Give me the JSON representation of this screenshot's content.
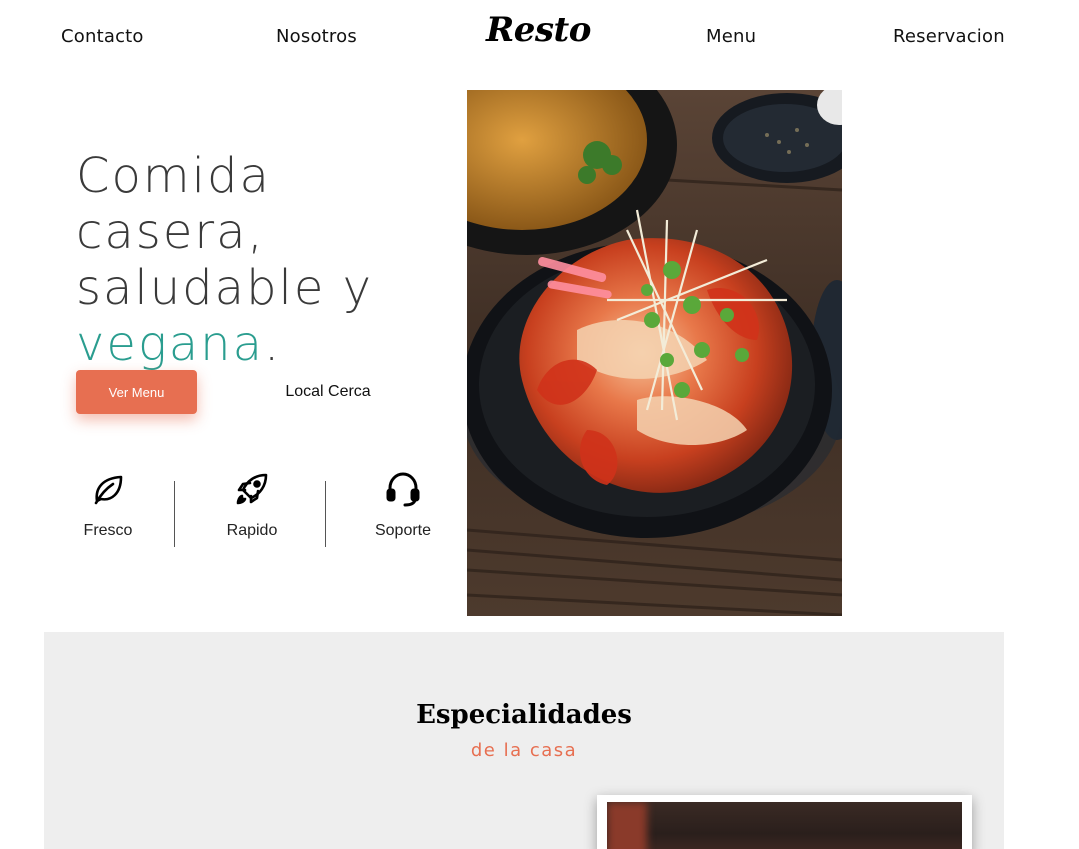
{
  "nav": {
    "logo": "Resto",
    "links": [
      "Contacto",
      "Nosotros",
      "Menu",
      "Reservacion"
    ]
  },
  "hero": {
    "title_line1": "Comida casera,",
    "title_line2": "saludable y",
    "title_accent": "vegana",
    "title_end": ".",
    "primary_button": "Ver Menu",
    "secondary_button": "Local Cerca",
    "features": [
      {
        "icon": "leaf-icon",
        "label": "Fresco"
      },
      {
        "icon": "rocket-icon",
        "label": "Rapido"
      },
      {
        "icon": "headset-icon",
        "label": "Soporte"
      }
    ],
    "image": "kimchi-bowl-photo"
  },
  "specialties": {
    "title": "Especialidades",
    "subtitle": "de la casa"
  },
  "colors": {
    "accent": "#e76f51",
    "teal": "#2a9d8f",
    "section_bg": "#eeeeee"
  }
}
